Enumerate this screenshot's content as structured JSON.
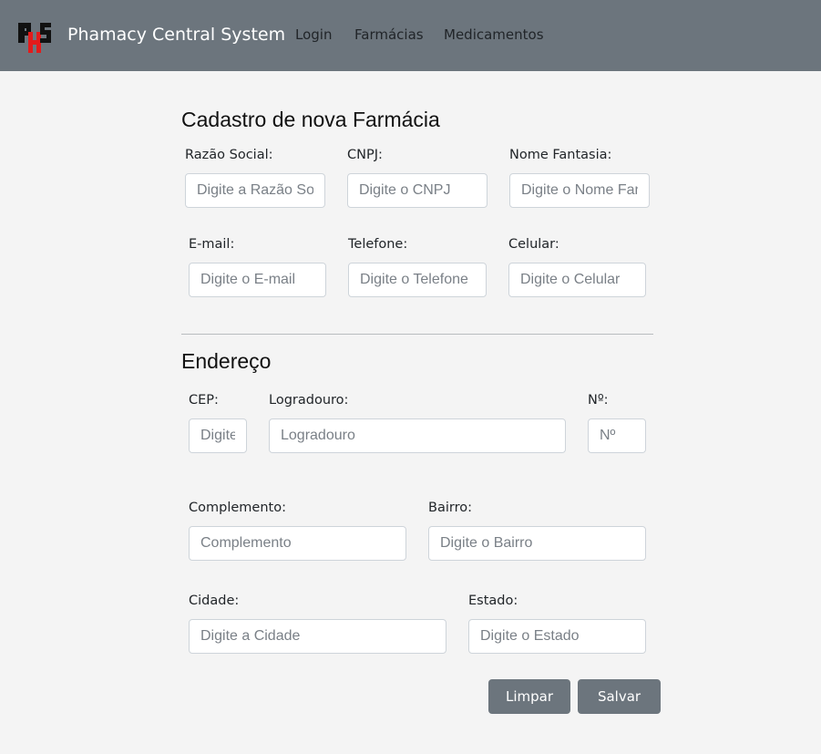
{
  "navbar": {
    "brand": "Phamacy Central System",
    "links": [
      "Login",
      "Farmácias",
      "Medicamentos"
    ]
  },
  "form": {
    "title": "Cadastro de nova Farmácia",
    "fields": {
      "razao_social": {
        "label": "Razão Social:",
        "placeholder": "Digite a Razão Social"
      },
      "cnpj": {
        "label": "CNPJ:",
        "placeholder": "Digite o CNPJ"
      },
      "nome_fantasia": {
        "label": "Nome Fantasia:",
        "placeholder": "Digite o Nome Fantasia"
      },
      "email": {
        "label": "E-mail:",
        "placeholder": "Digite o E-mail"
      },
      "telefone": {
        "label": "Telefone:",
        "placeholder": "Digite o Telefone"
      },
      "celular": {
        "label": "Celular:",
        "placeholder": "Digite o Celular"
      }
    }
  },
  "address": {
    "title": "Endereço",
    "fields": {
      "cep": {
        "label": "CEP:",
        "placeholder": "Digite o CEP"
      },
      "logradouro": {
        "label": "Logradouro:",
        "placeholder": "Logradouro"
      },
      "numero": {
        "label": "Nº:",
        "placeholder": "Nº"
      },
      "complemento": {
        "label": "Complemento:",
        "placeholder": "Complemento"
      },
      "bairro": {
        "label": "Bairro:",
        "placeholder": "Digite o Bairro"
      },
      "cidade": {
        "label": "Cidade:",
        "placeholder": "Digite a Cidade"
      },
      "estado": {
        "label": "Estado:",
        "placeholder": "Digite o Estado"
      }
    }
  },
  "buttons": {
    "clear": "Limpar",
    "save": "Salvar"
  },
  "colors": {
    "navbar": "#6c757d",
    "button": "#6c757d",
    "background": "#f4f4f4",
    "logo_red": "#e31b1b"
  },
  "icons": {
    "logo": "phs-logo-icon"
  }
}
